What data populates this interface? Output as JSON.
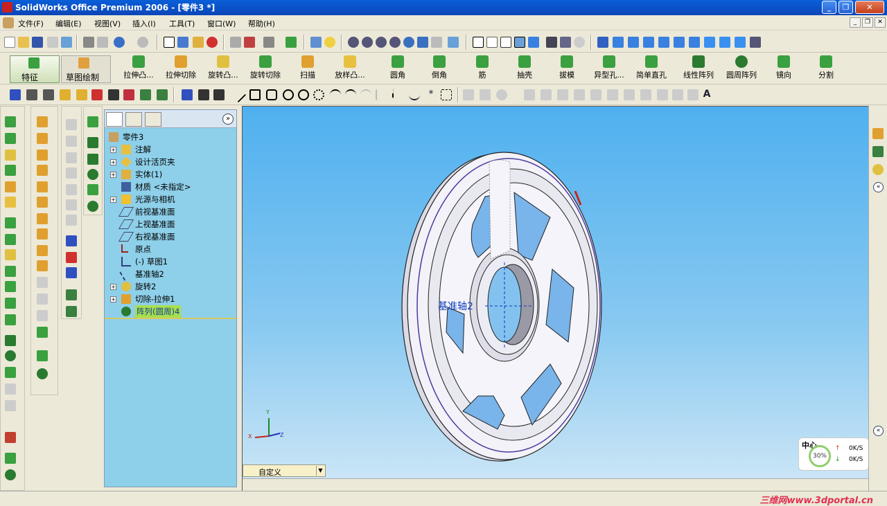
{
  "window": {
    "title": "SolidWorks Office Premium 2006 - [零件3 *]"
  },
  "menu": [
    "文件(F)",
    "编辑(E)",
    "视图(V)",
    "插入(I)",
    "工具(T)",
    "窗口(W)",
    "帮助(H)"
  ],
  "command_manager": {
    "feature_label": "特征",
    "sketch_label": "草图绘制",
    "buttons": [
      "拉伸凸...",
      "拉伸切除",
      "旋转凸...",
      "旋转切除",
      "扫描",
      "放样凸...",
      "圆角",
      "倒角",
      "筋",
      "抽壳",
      "拔模",
      "异型孔...",
      "简单直孔",
      "线性阵列",
      "圆周阵列",
      "镜向",
      "分割"
    ]
  },
  "feature_tree": {
    "root": "零件3",
    "items": [
      "注解",
      "设计活页夹",
      "实体(1)",
      "材质 <未指定>",
      "光源与相机",
      "前视基准面",
      "上视基准面",
      "右视基准面",
      "原点",
      "(-) 草图1",
      "基准轴2",
      "旋转2",
      "切除-拉伸1",
      "阵列(圆周)4"
    ]
  },
  "viewport": {
    "axis_label": "基准轴2",
    "view_combo": "自定义",
    "triad_x": "X",
    "triad_y": "Y",
    "triad_z": "Z"
  },
  "net_widget": {
    "title": "中心",
    "percent": "30%",
    "up": "0K/S",
    "down": "0K/S"
  },
  "watermark": "三维网www.3dportal.cn",
  "colors": {
    "title_bar": "#0b53cc",
    "viewport_top": "#4fb0ef",
    "tree_bg": "#8ecfe9",
    "selection": "#a8e04c"
  }
}
